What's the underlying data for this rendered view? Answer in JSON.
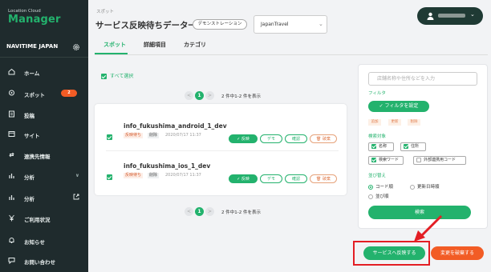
{
  "app": {
    "logo_small": "Location Cloud",
    "logo_main": "Manager",
    "org_name": "NAVITIME JAPAN"
  },
  "sidebar": {
    "items": [
      {
        "label": "ホーム",
        "icon": "home-icon"
      },
      {
        "label": "スポット",
        "icon": "map-pin-icon",
        "badge": "2"
      },
      {
        "label": "投稿",
        "icon": "document-icon"
      },
      {
        "label": "サイト",
        "icon": "browser-icon"
      },
      {
        "label": "連携先情報",
        "icon": "link-icon"
      },
      {
        "label": "分析",
        "icon": "bar-chart-icon",
        "chevron": "∨"
      },
      {
        "label": "分析",
        "icon": "bar-chart-icon"
      },
      {
        "label": "ご利用状況",
        "icon": "yen-icon"
      },
      {
        "label": "お知らせ",
        "icon": "bell-icon"
      },
      {
        "label": "お問い合わせ",
        "icon": "chat-icon"
      }
    ]
  },
  "header": {
    "breadcrumb": "スポット",
    "title": "サービス反映待ちデータ一覧",
    "demo_label": "デモンストレーション",
    "project": "JapanTravel"
  },
  "tabs": [
    "スポット",
    "詳細項目",
    "カテゴリ"
  ],
  "list": {
    "select_all": "すべて選択",
    "pager": {
      "prev": "<",
      "current": "1",
      "next": ">",
      "info": "2 件中1-2 件を表示"
    },
    "rows": [
      {
        "name": "info_fukushima_android_1_dev",
        "status": "反映待ち",
        "action": "削除",
        "date": "2020/07/17 11:37"
      },
      {
        "name": "info_fukushima_ios_1_dev",
        "status": "反映待ち",
        "action": "削除",
        "date": "2020/07/17 11:37"
      }
    ],
    "row_buttons": {
      "reflect": "✓ 反映",
      "demo": "デモ",
      "confirm": "確認",
      "discard": "🗑 破棄"
    }
  },
  "filter": {
    "search_placeholder": "店舗名称や住所などを入力",
    "filter_label": "フィルタ",
    "filter_button": "✓ フィルタを設定",
    "chips": [
      "追加",
      "更新",
      "削除"
    ],
    "target_label": "検索対象",
    "targets": [
      {
        "label": "名称",
        "checked": true
      },
      {
        "label": "住所",
        "checked": true
      },
      {
        "label": "検索ワード",
        "checked": true
      },
      {
        "label": "外部連携用コード",
        "checked": false
      }
    ],
    "sort_label": "並び替え",
    "sort_options": [
      {
        "label": "コード順",
        "selected": true
      },
      {
        "label": "更新日時順",
        "selected": false
      },
      {
        "label": "並び順",
        "selected": false
      }
    ],
    "search_button": "検索"
  },
  "footer_actions": {
    "reflect": "サービスへ反映する",
    "discard": "変更を破棄する"
  },
  "colors": {
    "accent": "#23b26d",
    "sidebar": "#1f2b2d",
    "warning": "#f25c25",
    "highlight": "#e31e24"
  }
}
